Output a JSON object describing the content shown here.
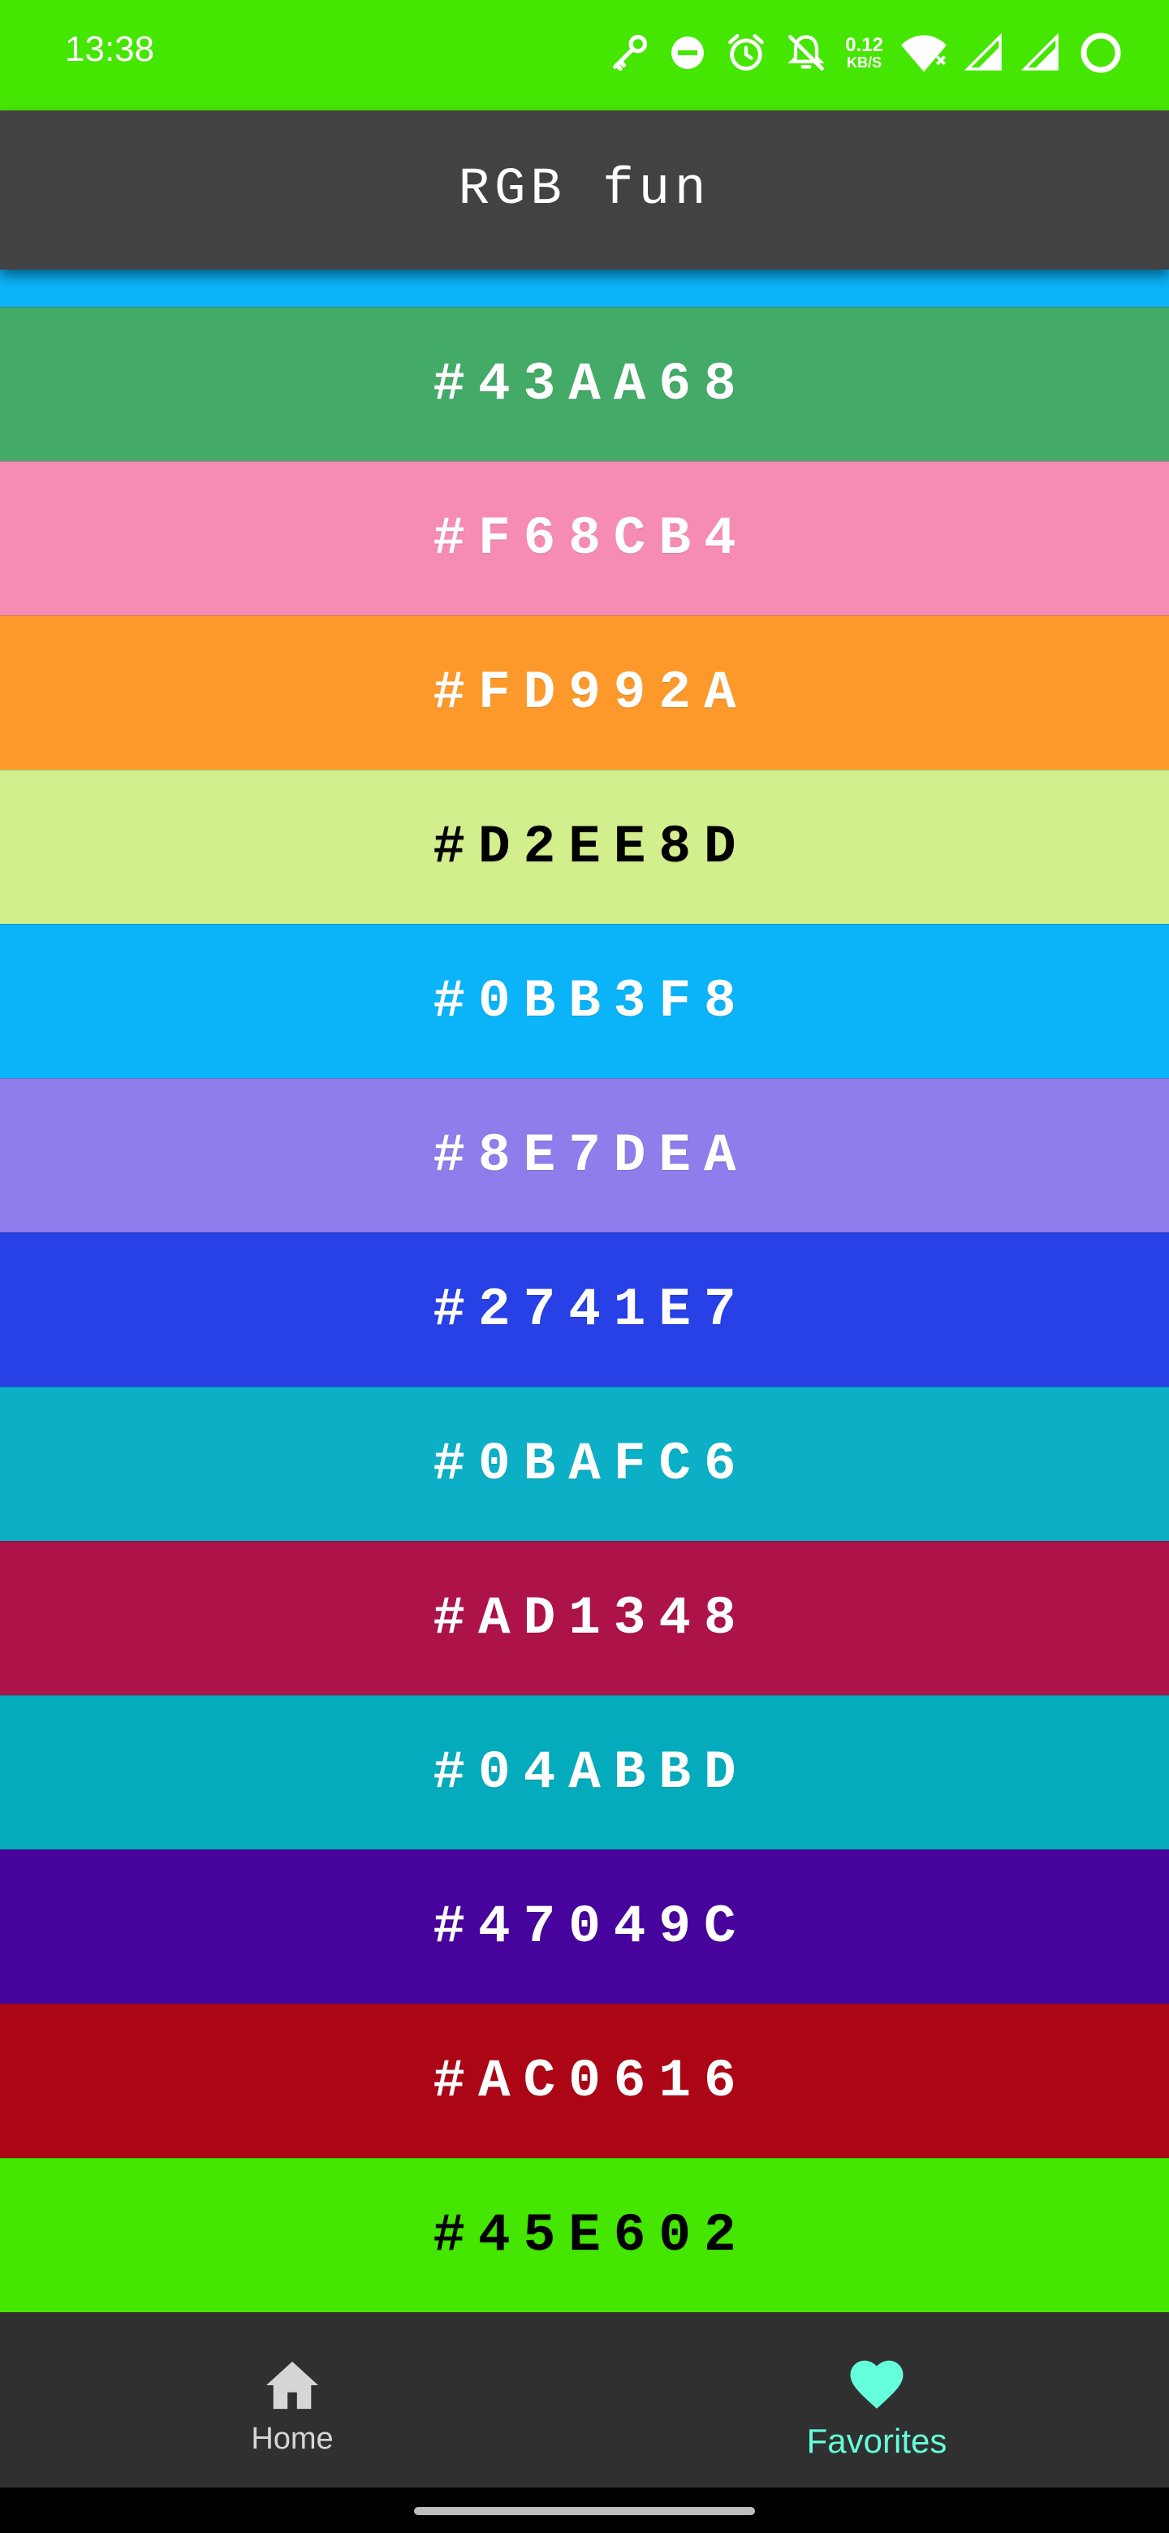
{
  "status_bar": {
    "time": "13:38",
    "net_speed_value": "0.12",
    "net_speed_unit": "KB/S",
    "background": "#45E602",
    "icons": [
      "key-icon",
      "dnd-icon",
      "alarm-icon",
      "bell-off-icon",
      "wifi-icon",
      "signal-icon",
      "signal-icon-2",
      "battery-ring-icon"
    ]
  },
  "app_bar": {
    "title": "RGB fun",
    "background": "#424242"
  },
  "color_list": {
    "partial_top_color": "#0BB3F8",
    "items": [
      {
        "hex": "#43AA68",
        "text_color": "#FFFFFF"
      },
      {
        "hex": "#F68CB4",
        "text_color": "#FFFFFF"
      },
      {
        "hex": "#FD992A",
        "text_color": "#FFFFFF"
      },
      {
        "hex": "#D2EE8D",
        "text_color": "#000000"
      },
      {
        "hex": "#0BB3F8",
        "text_color": "#FFFFFF"
      },
      {
        "hex": "#8E7DEA",
        "text_color": "#FFFFFF"
      },
      {
        "hex": "#2741E7",
        "text_color": "#FFFFFF"
      },
      {
        "hex": "#0BAFC6",
        "text_color": "#FFFFFF"
      },
      {
        "hex": "#AD1348",
        "text_color": "#FFFFFF"
      },
      {
        "hex": "#04ABBD",
        "text_color": "#FFFFFF"
      },
      {
        "hex": "#47049C",
        "text_color": "#FFFFFF"
      },
      {
        "hex": "#AC0616",
        "text_color": "#FFFFFF"
      },
      {
        "hex": "#45E602",
        "text_color": "#000000"
      }
    ]
  },
  "bottom_nav": {
    "background": "#303030",
    "items": [
      {
        "label": "Home",
        "icon": "home-icon",
        "selected": false,
        "color": "#D6D6D6"
      },
      {
        "label": "Favorites",
        "icon": "heart-icon",
        "selected": true,
        "color": "#64FFDA"
      }
    ]
  }
}
